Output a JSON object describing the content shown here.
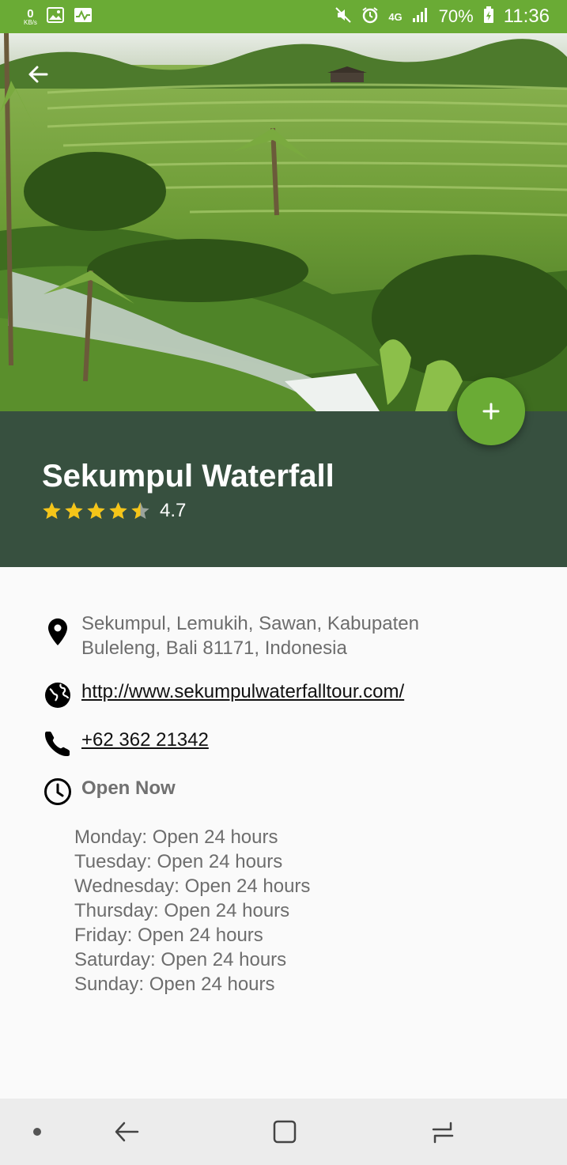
{
  "status_bar": {
    "net_speed_value": "0",
    "net_speed_unit": "KB/s",
    "network_type": "4G",
    "battery_percent": "70%",
    "time": "11:36"
  },
  "place": {
    "name": "Sekumpul Waterfall",
    "rating": "4.7",
    "rating_stars": 4.5
  },
  "details": {
    "address": "Sekumpul, Lemukih, Sawan, Kabupaten Buleleng, Bali 81171, Indonesia",
    "website": "http://www.sekumpulwaterfalltour.com/",
    "phone": "+62 362 21342",
    "open_status": "Open Now",
    "hours": [
      "Monday: Open 24 hours",
      "Tuesday: Open 24 hours",
      "Wednesday: Open 24 hours",
      "Thursday: Open 24 hours",
      "Friday: Open 24 hours",
      "Saturday: Open 24 hours",
      "Sunday: Open 24 hours"
    ]
  },
  "colors": {
    "accent": "#6aab35",
    "title_panel": "#37503f",
    "star": "#f5c518"
  }
}
